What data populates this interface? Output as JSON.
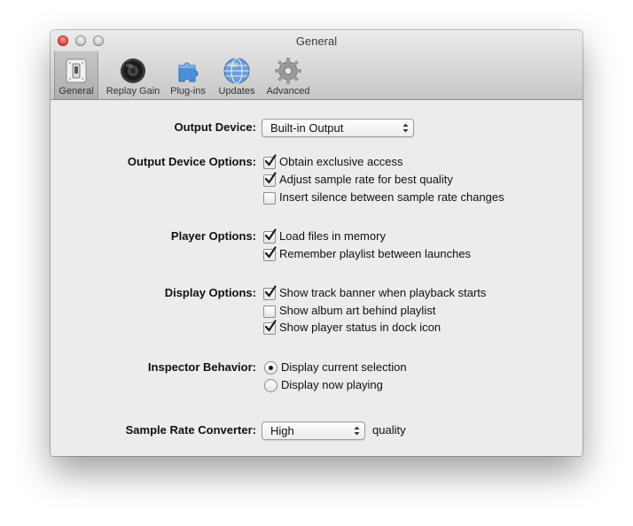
{
  "window": {
    "title": "General"
  },
  "toolbar": {
    "items": [
      {
        "label": "General",
        "icon": "switch-icon",
        "selected": true
      },
      {
        "label": "Replay Gain",
        "icon": "speaker-icon",
        "selected": false
      },
      {
        "label": "Plug-ins",
        "icon": "puzzle-piece-icon",
        "selected": false
      },
      {
        "label": "Updates",
        "icon": "globe-icon",
        "selected": false
      },
      {
        "label": "Advanced",
        "icon": "gear-icon",
        "selected": false
      }
    ]
  },
  "output_device": {
    "label": "Output Device:",
    "value": "Built-in Output"
  },
  "output_device_options": {
    "label": "Output Device Options:",
    "options": [
      {
        "label": "Obtain exclusive access",
        "checked": true
      },
      {
        "label": "Adjust sample rate for best quality",
        "checked": true
      },
      {
        "label": "Insert silence between sample rate changes",
        "checked": false
      }
    ]
  },
  "player_options": {
    "label": "Player Options:",
    "options": [
      {
        "label": "Load files in memory",
        "checked": true
      },
      {
        "label": "Remember playlist between launches",
        "checked": true
      }
    ]
  },
  "display_options": {
    "label": "Display Options:",
    "options": [
      {
        "label": "Show track banner when playback starts",
        "checked": true
      },
      {
        "label": "Show album art behind playlist",
        "checked": false
      },
      {
        "label": "Show player status in dock icon",
        "checked": true
      }
    ]
  },
  "inspector_behavior": {
    "label": "Inspector Behavior:",
    "options": [
      {
        "label": "Display current selection",
        "selected": true
      },
      {
        "label": "Display now playing",
        "selected": false
      }
    ]
  },
  "sample_rate_converter": {
    "label": "Sample Rate Converter:",
    "value": "High",
    "suffix": "quality"
  }
}
